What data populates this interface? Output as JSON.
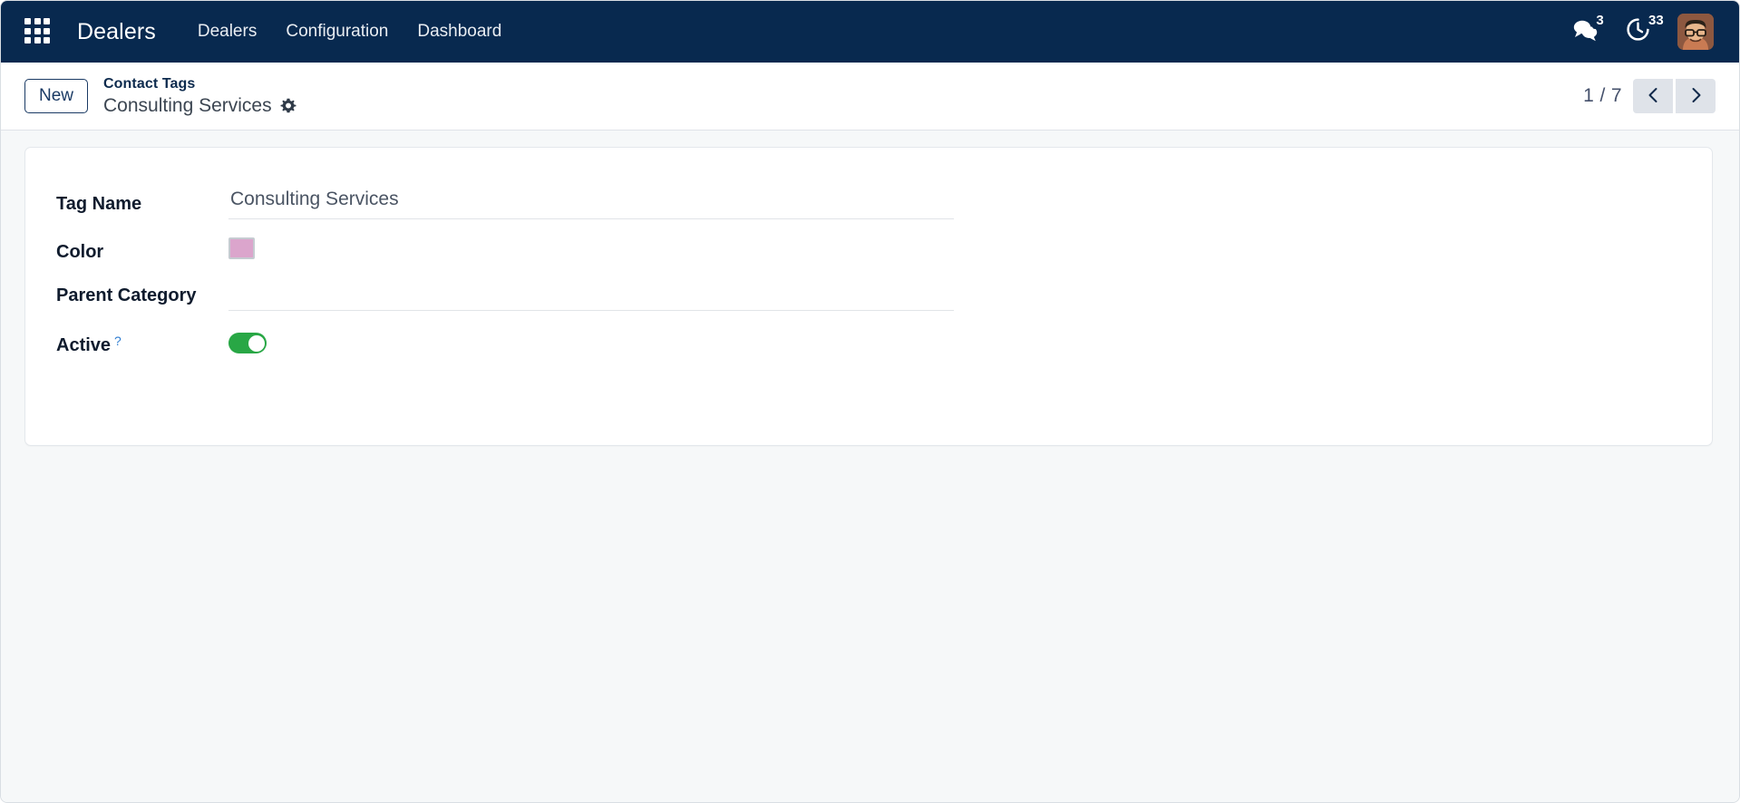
{
  "navbar": {
    "apps_icon": "apps-grid-icon",
    "brand": "Dealers",
    "menu_items": [
      {
        "label": "Dealers"
      },
      {
        "label": "Configuration"
      },
      {
        "label": "Dashboard"
      }
    ],
    "systray": {
      "messages": {
        "icon": "messages-icon",
        "badge": "3"
      },
      "activities": {
        "icon": "clock-activity-icon",
        "badge": "33"
      },
      "avatar": {
        "icon": "user-avatar"
      }
    },
    "colors": {
      "background": "#08294f",
      "text": "#ffffff"
    }
  },
  "control_panel": {
    "new_button": "New",
    "breadcrumb_parent": "Contact Tags",
    "breadcrumb_current": "Consulting Services",
    "settings_icon": "gear-icon",
    "pager": {
      "counter": "1 / 7",
      "previous_icon": "chevron-left-icon",
      "next_icon": "chevron-right-icon"
    }
  },
  "form": {
    "fields": {
      "tag_name": {
        "label": "Tag Name",
        "value": "Consulting Services",
        "placeholder": ""
      },
      "color": {
        "label": "Color",
        "swatch_hex": "#dba5cc"
      },
      "parent_category": {
        "label": "Parent Category",
        "value": "",
        "placeholder": ""
      },
      "active": {
        "label": "Active",
        "help_marker": "?",
        "state": "on",
        "toggle_on_hex": "#28a745"
      }
    }
  }
}
